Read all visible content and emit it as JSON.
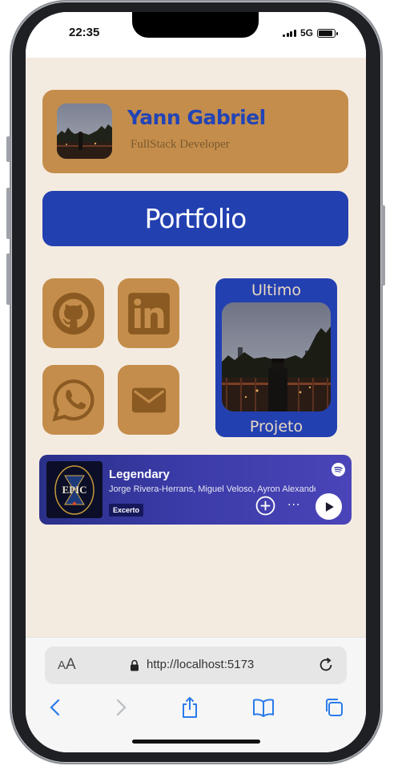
{
  "status_bar": {
    "time": "22:35",
    "network": "5G",
    "battery_level": 0.9
  },
  "profile": {
    "name": "Yann Gabriel",
    "role": "FullStack Developer",
    "avatar": "night-cityscape-photo"
  },
  "portfolio_button": {
    "label": "Portfolio"
  },
  "socials": [
    {
      "icon": "github-icon",
      "color": "#8a5a22"
    },
    {
      "icon": "linkedin-icon",
      "color": "#8a5a22"
    },
    {
      "icon": "whatsapp-icon",
      "color": "#8a5a22"
    },
    {
      "icon": "mail-icon",
      "color": "#8a5a22"
    }
  ],
  "last_project": {
    "top_label": "Ultimo",
    "bottom_label": "Projeto",
    "image": "night-cityscape-photo"
  },
  "spotify": {
    "title": "Legendary",
    "artists": "Jorge Rivera-Herrans, Miguel Veloso, Ayron Alexander",
    "badge": "Excerto",
    "more": "···"
  },
  "browser": {
    "text_size_label": "A",
    "text_size_small": "A",
    "url": "http://localhost:5173"
  },
  "colors": {
    "background": "#f4ebe0",
    "accent_blue": "#2340b0",
    "card_tan": "#c48d4b",
    "name_blue": "#2244b6"
  }
}
